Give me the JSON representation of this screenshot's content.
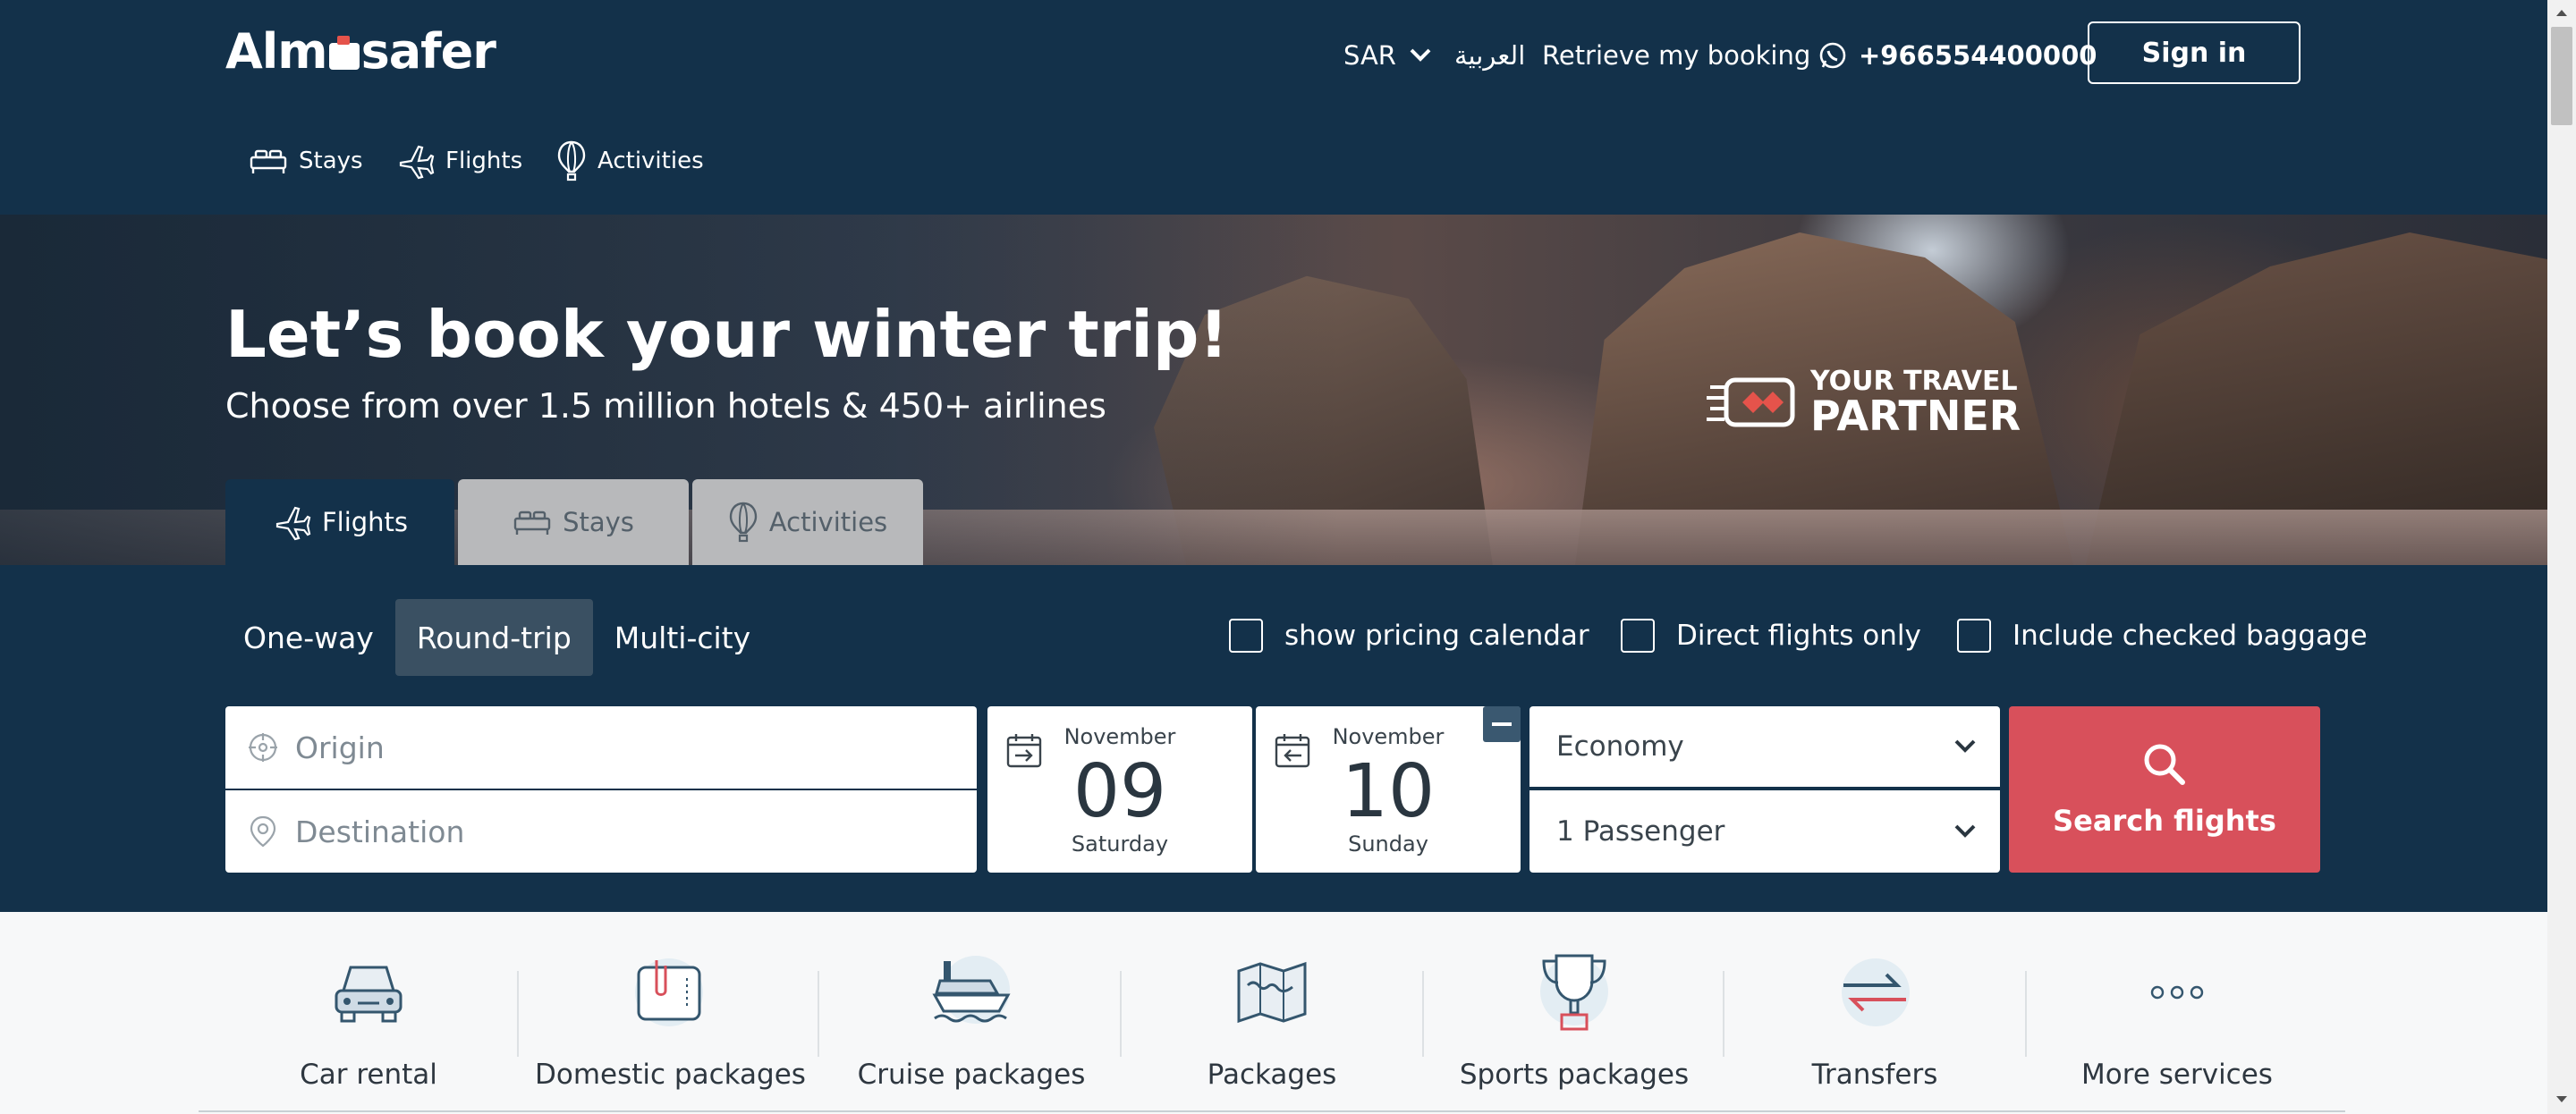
{
  "header": {
    "logo": "Almosafer",
    "currency": "SAR",
    "language": "العربية",
    "retrieve_booking": "Retrieve my booking",
    "phone": "+966554400000",
    "sign_in": "Sign in"
  },
  "service_nav": [
    {
      "label": "Stays",
      "icon": "bed-icon"
    },
    {
      "label": "Flights",
      "icon": "plane-icon"
    },
    {
      "label": "Activities",
      "icon": "balloon-icon"
    }
  ],
  "hero": {
    "title": "Let’s book your winter trip!",
    "subtitle": "Choose from over 1.5 million hotels & 450+ airlines",
    "partner_line1": "YOUR TRAVEL",
    "partner_line2": "PARTNER"
  },
  "tabs": [
    {
      "label": "Flights",
      "active": true
    },
    {
      "label": "Stays",
      "active": false
    },
    {
      "label": "Activities",
      "active": false
    }
  ],
  "search": {
    "trip_types": [
      "One-way",
      "Round-trip",
      "Multi-city"
    ],
    "selected_trip": "Round-trip",
    "options": {
      "pricing_calendar": "show pricing calendar",
      "direct_only": "Direct flights only",
      "checked_baggage": "Include checked baggage"
    },
    "origin_placeholder": "Origin",
    "destination_placeholder": "Destination",
    "depart": {
      "month": "November",
      "day": "09",
      "weekday": "Saturday"
    },
    "return": {
      "month": "November",
      "day": "10",
      "weekday": "Sunday"
    },
    "cabin_class": "Economy",
    "passengers": "1 Passenger",
    "search_button": "Search flights"
  },
  "services": [
    {
      "label": "Car rental",
      "icon": "car-icon"
    },
    {
      "label": "Domestic packages",
      "icon": "package-icon"
    },
    {
      "label": "Cruise packages",
      "icon": "ship-icon"
    },
    {
      "label": "Packages",
      "icon": "map-icon"
    },
    {
      "label": "Sports packages",
      "icon": "trophy-icon"
    },
    {
      "label": "Transfers",
      "icon": "transfer-icon"
    },
    {
      "label": "More services",
      "icon": "more-icon"
    }
  ],
  "colors": {
    "navy": "#13314a",
    "accent_red": "#d8505b",
    "inactive_tab": "#b8b9bb"
  }
}
